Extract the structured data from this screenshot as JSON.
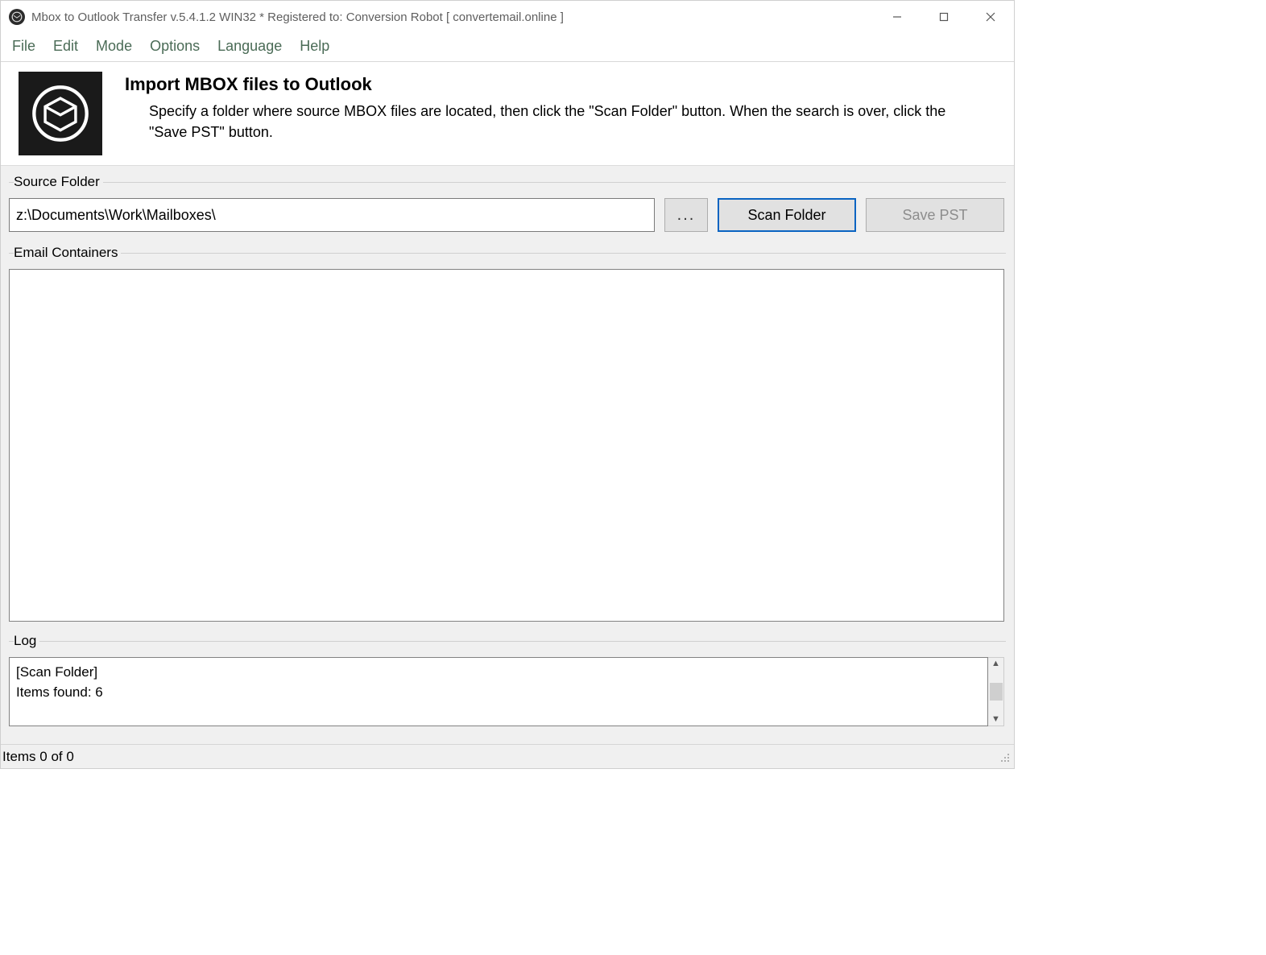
{
  "window": {
    "title": "Mbox to Outlook Transfer v.5.4.1.2 WIN32 * Registered to: Conversion Robot [ convertemail.online ]"
  },
  "menu": {
    "items": [
      "File",
      "Edit",
      "Mode",
      "Options",
      "Language",
      "Help"
    ]
  },
  "header": {
    "headline": "Import MBOX files to Outlook",
    "subtext": "Specify a folder where source MBOX files are located, then click the \"Scan Folder\" button. When the search is over, click the \"Save PST\" button."
  },
  "source_folder": {
    "legend": "Source Folder",
    "path": "z:\\Documents\\Work\\Mailboxes\\",
    "browse_label": "...",
    "scan_label": "Scan Folder",
    "save_label": "Save PST"
  },
  "containers": {
    "legend": "Email Containers"
  },
  "log": {
    "legend": "Log",
    "lines": "[Scan Folder]\nItems found: 6"
  },
  "status": {
    "text": "Items 0 of 0"
  }
}
